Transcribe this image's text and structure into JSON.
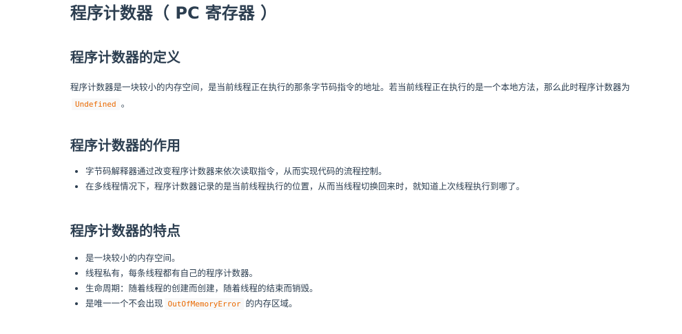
{
  "title": "程序计数器（ PC 寄存器 ）",
  "sections": [
    {
      "heading": "程序计数器的定义",
      "paragraph": {
        "text_before": "程序计数器是一块较小的内存空间，是当前线程正在执行的那条字节码指令的地址。若当前线程正在执行的是一个本地方法，那么此时程序计数器为",
        "code": "Undefined",
        "text_after": "。"
      }
    },
    {
      "heading": "程序计数器的作用",
      "items": [
        "字节码解释器通过改变程序计数器来依次读取指令，从而实现代码的流程控制。",
        "在多线程情况下，程序计数器记录的是当前线程执行的位置，从而当线程切换回来时，就知道上次线程执行到哪了。"
      ]
    },
    {
      "heading": "程序计数器的特点",
      "items": [
        "是一块较小的内存空间。",
        "线程私有，每条线程都有自己的程序计数器。",
        "生命周期：随着线程的创建而创建，随着线程的结束而销毁。"
      ],
      "last_item": {
        "text_before": "是唯一一个不会出现",
        "code": "OutOfMemoryError",
        "text_after": "的内存区域。"
      }
    }
  ]
}
